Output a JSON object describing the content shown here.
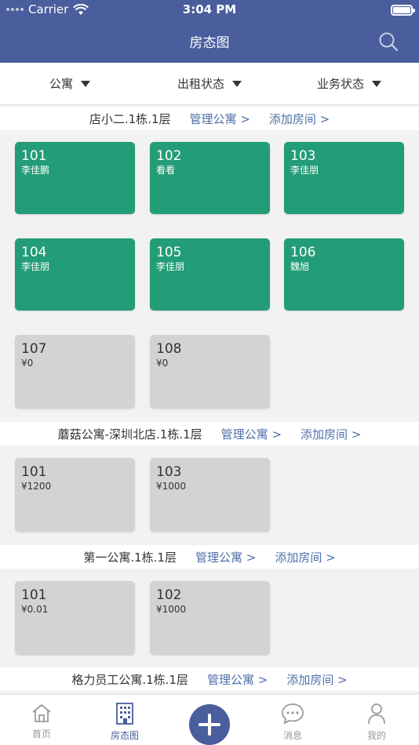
{
  "status_bar": {
    "carrier": "Carrier",
    "time": "3:04 PM"
  },
  "nav": {
    "title": "房态图"
  },
  "filters": [
    {
      "label": "公寓"
    },
    {
      "label": "出租状态"
    },
    {
      "label": "业务状态"
    }
  ],
  "sections": [
    {
      "name": "店小二.1栋.1层",
      "manage_label": "管理公寓 >",
      "add_label": "添加房间 >",
      "rooms": [
        {
          "number": "101",
          "sub": "李佳鹏",
          "status": "occupied"
        },
        {
          "number": "102",
          "sub": "看看",
          "status": "occupied"
        },
        {
          "number": "103",
          "sub": "李佳朋",
          "status": "occupied"
        },
        {
          "number": "104",
          "sub": "李佳朋",
          "status": "occupied"
        },
        {
          "number": "105",
          "sub": "李佳朋",
          "status": "occupied"
        },
        {
          "number": "106",
          "sub": "魏旭",
          "status": "occupied"
        },
        {
          "number": "107",
          "sub": "¥0",
          "status": "vacant"
        },
        {
          "number": "108",
          "sub": "¥0",
          "status": "vacant"
        }
      ]
    },
    {
      "name": "蘑菇公寓-深圳北店.1栋.1层",
      "manage_label": "管理公寓 >",
      "add_label": "添加房间 >",
      "rooms": [
        {
          "number": "101",
          "sub": "¥1200",
          "status": "vacant"
        },
        {
          "number": "103",
          "sub": "¥1000",
          "status": "vacant"
        }
      ]
    },
    {
      "name": "第一公寓.1栋.1层",
      "manage_label": "管理公寓 >",
      "add_label": "添加房间 >",
      "rooms": [
        {
          "number": "101",
          "sub": "¥0.01",
          "status": "vacant"
        },
        {
          "number": "102",
          "sub": "¥1000",
          "status": "vacant"
        }
      ]
    },
    {
      "name": "格力员工公寓.1栋.1层",
      "manage_label": "管理公寓 >",
      "add_label": "添加房间 >",
      "rooms": []
    }
  ],
  "tabbar": {
    "home": "首页",
    "room_map": "房态图",
    "messages": "消息",
    "mine": "我的"
  },
  "colors": {
    "brand": "#4a5d9c",
    "occupied": "#239d77",
    "vacant": "#d3d3d3",
    "link": "#4f70a8"
  },
  "icons": {
    "search": "search-icon",
    "home": "home-icon",
    "building": "building-icon",
    "add": "plus-icon",
    "chat": "chat-icon",
    "user": "user-icon"
  }
}
